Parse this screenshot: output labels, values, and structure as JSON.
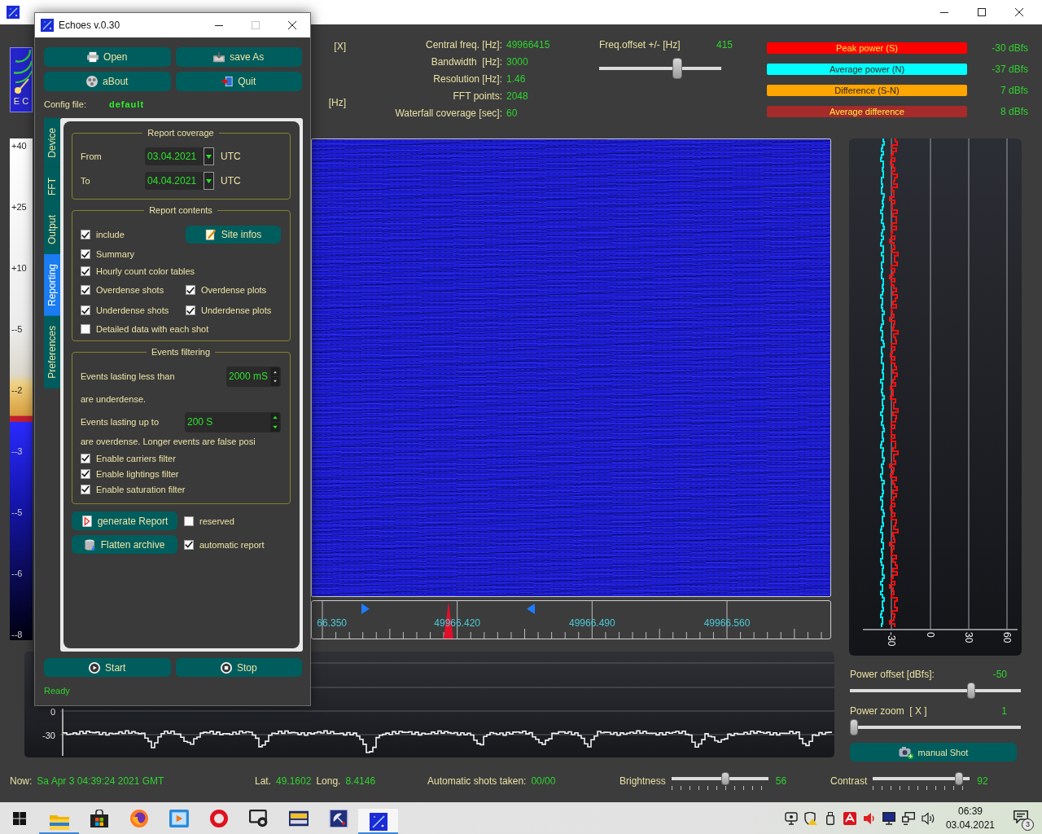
{
  "main_window": {
    "logo_text": "E C"
  },
  "top_info": {
    "units": [
      "[X]",
      "[Hz]"
    ],
    "params": [
      {
        "label": "Central freq. [Hz]:",
        "value": "49966415"
      },
      {
        "label": "Bandwidth  [Hz]:",
        "value": "3000"
      },
      {
        "label": "Resolution [Hz]:",
        "value": "1.46"
      },
      {
        "label": "FFT points:",
        "value": "2048"
      },
      {
        "label": "Waterfall coverage [sec]:",
        "value": "60"
      }
    ],
    "freq_offset": {
      "label": "Freq.offset +/- [Hz]",
      "value": "415",
      "level": 0.65
    },
    "legend": [
      {
        "label": "Peak power (S)",
        "color": "#ff0000",
        "reading": "-30 dBfs"
      },
      {
        "label": "Average power (N)",
        "color": "#00ffff",
        "reading": "-37 dBfs"
      },
      {
        "label": "Difference (S-N)",
        "color": "#ffa500",
        "reading": "7 dBfs"
      },
      {
        "label": "Average difference",
        "color": "#a52a2a",
        "reading": "8 dBfs"
      }
    ]
  },
  "color_scale": {
    "labels": [
      "+40",
      "+25",
      "+10",
      "--5",
      "--2",
      "--3",
      "--5",
      "--6",
      "--8"
    ]
  },
  "freq_axis": {
    "labels": [
      "66.350",
      "49966.420",
      "49966.490",
      "49966.560"
    ]
  },
  "power_chart": {
    "axis_labels": [
      "-30",
      "0",
      "30",
      "60"
    ]
  },
  "power_controls": [
    {
      "label": "Power offset [dBfs]:",
      "value": "-50",
      "level": 0.72
    },
    {
      "label": "Power zoom  [ X ]",
      "value": "1",
      "level": 0
    }
  ],
  "manual_shot": {
    "label": "manual Shot"
  },
  "signal_chart": {
    "axis_labels": [
      "0",
      "-30"
    ]
  },
  "status_bar": {
    "now": {
      "label": "Now:",
      "value": "Sa Apr 3 04:39:24 2021 GMT"
    },
    "position": [
      {
        "label": "Lat.",
        "value": "49.1602"
      },
      {
        "label": "Long.",
        "value": "8.4146"
      }
    ],
    "shots": {
      "label": "Automatic shots taken:",
      "value": "00/00"
    },
    "sliders": [
      {
        "label": "Brightness",
        "level": 0.56,
        "value": "56"
      },
      {
        "label": "Contrast",
        "level": 0.92,
        "value": "92"
      }
    ]
  },
  "dialog": {
    "title": "Echoes v.0.30",
    "buttons": [
      "Open",
      "save As",
      "aBout",
      "Quit"
    ],
    "config": {
      "label": "Config file:",
      "value": "default"
    },
    "tabs": [
      {
        "label": "Device",
        "selected": false
      },
      {
        "label": "FFT",
        "selected": false
      },
      {
        "label": "Output",
        "selected": false
      },
      {
        "label": "Reporting",
        "selected": true
      },
      {
        "label": "Preferences",
        "selected": false
      }
    ],
    "report_coverage": {
      "title": "Report coverage",
      "rows": [
        {
          "label": "From",
          "date": "03.04.2021",
          "zone": "UTC"
        },
        {
          "label": "To",
          "date": "04.04.2021",
          "zone": "UTC"
        }
      ]
    },
    "report_contents": {
      "title": "Report contents",
      "site_infos": "Site infos",
      "rows": [
        {
          "items": [
            {
              "label": "include",
              "checked": true
            }
          ]
        },
        {
          "items": [
            {
              "label": "Summary",
              "checked": true
            }
          ]
        },
        {
          "items": [
            {
              "label": "Hourly count color tables",
              "checked": true
            }
          ]
        },
        {
          "items": [
            {
              "label": "Overdense shots",
              "checked": true
            },
            {
              "label": "Overdense plots",
              "checked": true
            }
          ]
        },
        {
          "items": [
            {
              "label": "Underdense shots",
              "checked": true
            },
            {
              "label": "Underdense plots",
              "checked": true
            }
          ]
        },
        {
          "items": [
            {
              "label": "Detailed data with each shot",
              "checked": false
            }
          ]
        }
      ]
    },
    "events_filtering": {
      "title": "Events filtering",
      "less_than": {
        "label": "Events lasting less than",
        "value": "2000 mS"
      },
      "underdense_note": "are underdense.",
      "up_to": {
        "label": "Events lasting up to",
        "value": "200 S"
      },
      "overdense_note": "are overdense. Longer events are false posi",
      "filters": [
        {
          "label": "Enable carriers filter",
          "checked": true
        },
        {
          "label": "Enable lightings filter",
          "checked": true
        },
        {
          "label": "Enable saturation filter",
          "checked": true
        }
      ]
    },
    "actions": [
      {
        "button": "generate Report",
        "option": {
          "label": "reserved",
          "checked": false
        }
      },
      {
        "button": "Flatten archive",
        "option": {
          "label": "automatic report",
          "checked": true
        }
      }
    ],
    "run_buttons": [
      "Start",
      "Stop"
    ],
    "status": "Ready"
  },
  "taskbar": {
    "apps": [
      {
        "running": true,
        "selected": false
      },
      {
        "running": false,
        "selected": false
      },
      {
        "running": false,
        "selected": false
      },
      {
        "running": false,
        "selected": false
      },
      {
        "running": false,
        "selected": false
      },
      {
        "running": false,
        "selected": false
      },
      {
        "running": false,
        "selected": false
      },
      {
        "running": false,
        "selected": false
      },
      {
        "running": true,
        "selected": true
      }
    ],
    "clock": {
      "time": "06:39",
      "date": "03.04.2021"
    },
    "notifications": "3"
  }
}
